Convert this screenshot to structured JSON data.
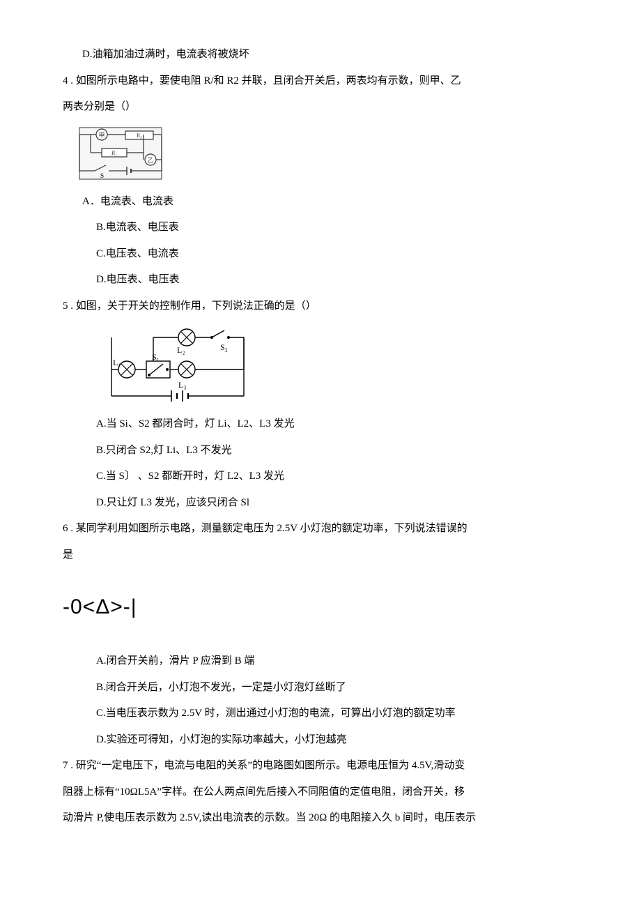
{
  "q3": {
    "optD": "D.油箱加油过满时，电流表将被烧坏"
  },
  "q4": {
    "stem1": "4  . 如图所示电路中，要使电阻 R/和 R2 并联，且闭合开关后，两表均有示数，则甲、乙",
    "stem2": "两表分别是（）",
    "optA": "A．电流表、电流表",
    "optB": "B.电流表、电压表",
    "optC": "C.电压表、电流表",
    "optD": "D.电压表、电压表"
  },
  "q5": {
    "stem": "5  . 如图，关于开关的控制作用，下列说法正确的是（）",
    "optA": "A.当 Si、S2 都闭合时，灯 Li、L2、L3 发光",
    "optB": "B.只闭合 S2,灯 Li、L3 不发光",
    "optC": "C.当 S〕 、S2 都断开时，灯 L2、L3 发光",
    "optD": "D.只让灯 L3 发光，应该只闭合 Sl"
  },
  "q6": {
    "stem1": "6  . 某同学利用如图所示电路，测量额定电压为 2.5V 小灯泡的额定功率，下列说法错误的",
    "stem2": "是",
    "formula": "-0<Δ>-|",
    "optA": "A.闭合开关前，滑片 P 应滑到 B 端",
    "optB": "B.闭合开关后，小灯泡不发光，一定是小灯泡灯丝断了",
    "optC": "C.当电压表示数为 2.5V 时，测出通过小灯泡的电流，可算出小灯泡的额定功率",
    "optD": "D.实验还可得知，小灯泡的实际功率越大，小灯泡越亮"
  },
  "q7": {
    "stem1": "7  . 研究“一定电压下，电流与电阻的关系”的电路图如图所示。电源电压恒为 4.5V,滑动变",
    "stem2": "阻器上标有“10ΩL5A”字样。在公人两点间先后接入不同阻值的定值电阻，闭合开关，移",
    "stem3": "动滑片 P,使电压表示数为 2.5V,读出电流表的示数。当 20Ω 的电阻接入久 b 间时，电压表示"
  },
  "diagram4": {
    "labels": {
      "r1": "R₁",
      "r2": "R₂",
      "s": "S",
      "meter": "甲"
    }
  },
  "diagram5": {
    "labels": {
      "l1": "L₁",
      "l2": "L₂",
      "l3": "L₃",
      "s1": "S₁",
      "s2": "S₂"
    }
  }
}
